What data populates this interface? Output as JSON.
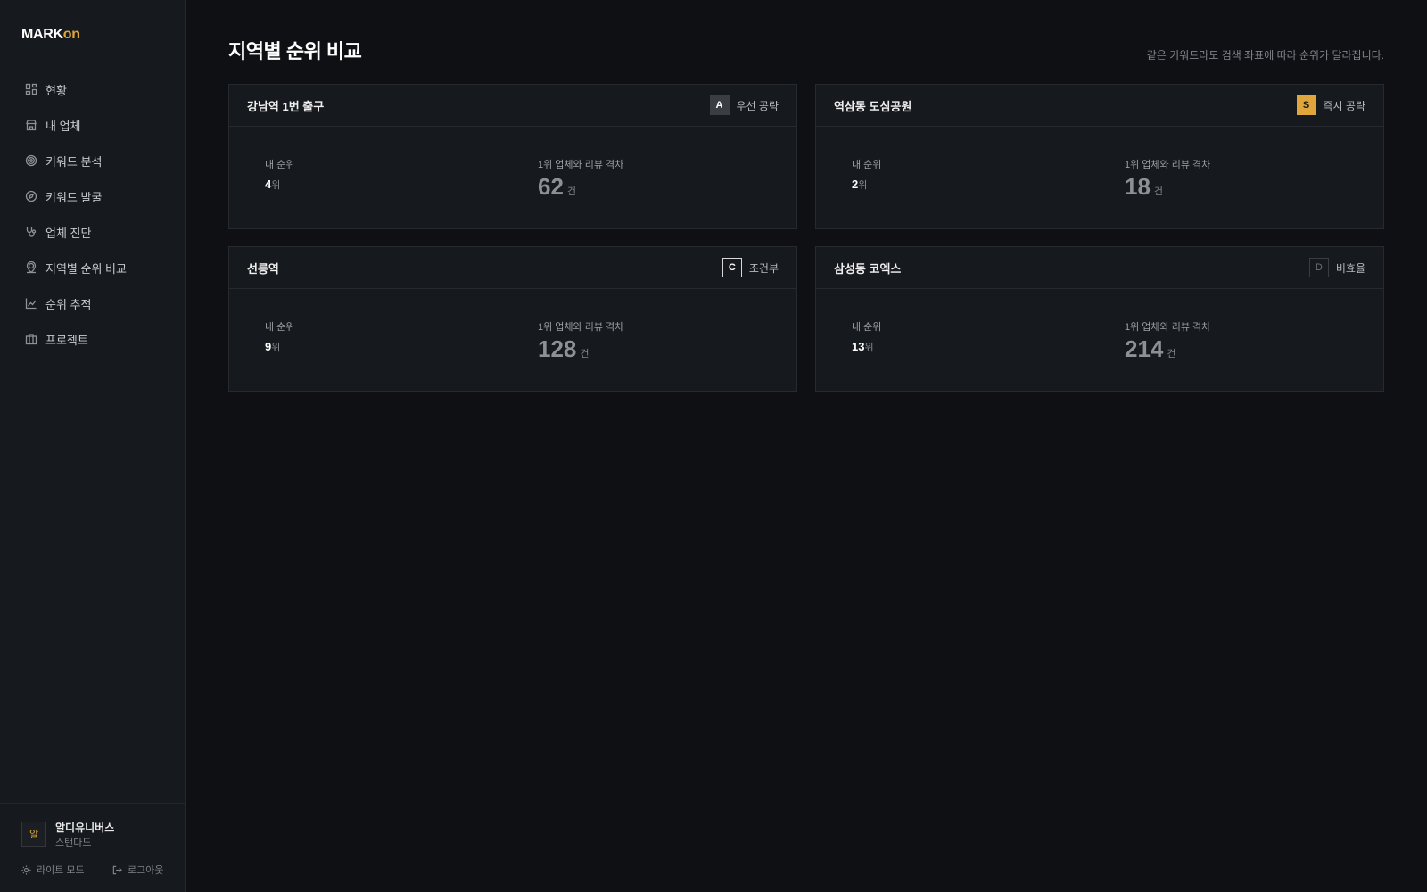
{
  "app": {
    "logo_mark": "MARK",
    "logo_on": "on"
  },
  "sidebar": {
    "items": [
      {
        "label": "현황",
        "icon": "grid-icon"
      },
      {
        "label": "내 업체",
        "icon": "store-icon"
      },
      {
        "label": "키워드 분석",
        "icon": "target-icon"
      },
      {
        "label": "키워드 발굴",
        "icon": "compass-icon"
      },
      {
        "label": "업체 진단",
        "icon": "stethoscope-icon"
      },
      {
        "label": "지역별 순위 비교",
        "icon": "map-pin-user-icon"
      },
      {
        "label": "순위 추적",
        "icon": "line-chart-icon"
      },
      {
        "label": "프로젝트",
        "icon": "briefcase-icon"
      }
    ]
  },
  "user": {
    "avatar_initial": "알",
    "name": "알디유니버스",
    "plan": "스탠다드",
    "theme_toggle": "라이트 모드",
    "logout": "로그아웃"
  },
  "page": {
    "title": "지역별 순위 비교",
    "description": "같은 키워드라도 검색 좌표에 따라 순위가 달라집니다."
  },
  "labels": {
    "my_rank": "내 순위",
    "review_gap": "1위 업체와 리뷰 격차",
    "rank_unit": "위",
    "count_unit": "건"
  },
  "cards": [
    {
      "location": "강남역 1번 출구",
      "grade": "A",
      "grade_label": "우선 공략",
      "rank": "4",
      "review_gap": "62"
    },
    {
      "location": "역삼동 도심공원",
      "grade": "S",
      "grade_label": "즉시 공략",
      "rank": "2",
      "review_gap": "18"
    },
    {
      "location": "선릉역",
      "grade": "C",
      "grade_label": "조건부",
      "rank": "9",
      "review_gap": "128"
    },
    {
      "location": "삼성동 코엑스",
      "grade": "D",
      "grade_label": "비효율",
      "rank": "13",
      "review_gap": "214"
    }
  ],
  "colors": {
    "accent": "#e0a63c",
    "background": "#0e1013",
    "sidebar": "#16191d"
  }
}
